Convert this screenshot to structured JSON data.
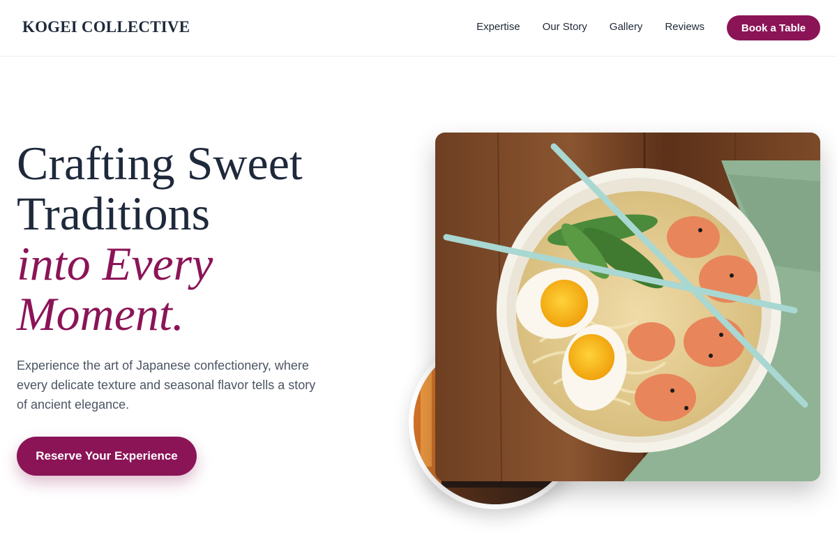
{
  "brand": {
    "name": "KOGEI COLLECTIVE",
    "accent_color": "#8b1457"
  },
  "nav": {
    "items": [
      {
        "label": "Expertise"
      },
      {
        "label": "Our Story"
      },
      {
        "label": "Gallery"
      },
      {
        "label": "Reviews"
      }
    ],
    "cta_label": "Book a Table"
  },
  "hero": {
    "headline_line1": "Crafting Sweet",
    "headline_line2": "Traditions",
    "headline_accent_line1": "into Every",
    "headline_accent_line2": "Moment.",
    "description": "Experience the art of Japanese confectionery, where every delicate texture and seasonal flavor tells a story of ancient elegance.",
    "button_label": "Reserve Your Experience"
  },
  "images": {
    "main": {
      "icon": "ramen-bowl-photo",
      "description_visible": false
    },
    "secondary": {
      "icon": "restaurant-interior-photo"
    }
  }
}
